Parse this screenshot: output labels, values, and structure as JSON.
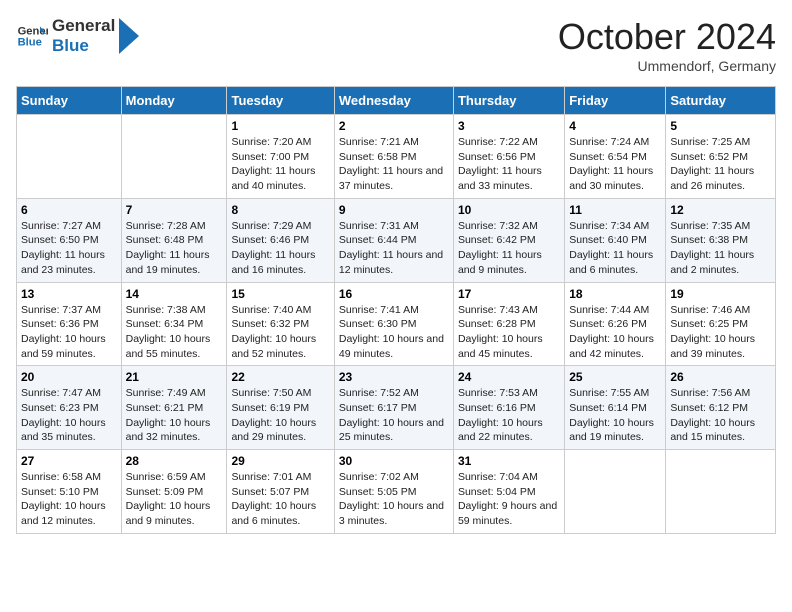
{
  "header": {
    "logo_line1": "General",
    "logo_line2": "Blue",
    "month": "October 2024",
    "location": "Ummendorf, Germany"
  },
  "weekdays": [
    "Sunday",
    "Monday",
    "Tuesday",
    "Wednesday",
    "Thursday",
    "Friday",
    "Saturday"
  ],
  "weeks": [
    [
      {
        "day": "",
        "info": ""
      },
      {
        "day": "",
        "info": ""
      },
      {
        "day": "1",
        "info": "Sunrise: 7:20 AM\nSunset: 7:00 PM\nDaylight: 11 hours and 40 minutes."
      },
      {
        "day": "2",
        "info": "Sunrise: 7:21 AM\nSunset: 6:58 PM\nDaylight: 11 hours and 37 minutes."
      },
      {
        "day": "3",
        "info": "Sunrise: 7:22 AM\nSunset: 6:56 PM\nDaylight: 11 hours and 33 minutes."
      },
      {
        "day": "4",
        "info": "Sunrise: 7:24 AM\nSunset: 6:54 PM\nDaylight: 11 hours and 30 minutes."
      },
      {
        "day": "5",
        "info": "Sunrise: 7:25 AM\nSunset: 6:52 PM\nDaylight: 11 hours and 26 minutes."
      }
    ],
    [
      {
        "day": "6",
        "info": "Sunrise: 7:27 AM\nSunset: 6:50 PM\nDaylight: 11 hours and 23 minutes."
      },
      {
        "day": "7",
        "info": "Sunrise: 7:28 AM\nSunset: 6:48 PM\nDaylight: 11 hours and 19 minutes."
      },
      {
        "day": "8",
        "info": "Sunrise: 7:29 AM\nSunset: 6:46 PM\nDaylight: 11 hours and 16 minutes."
      },
      {
        "day": "9",
        "info": "Sunrise: 7:31 AM\nSunset: 6:44 PM\nDaylight: 11 hours and 12 minutes."
      },
      {
        "day": "10",
        "info": "Sunrise: 7:32 AM\nSunset: 6:42 PM\nDaylight: 11 hours and 9 minutes."
      },
      {
        "day": "11",
        "info": "Sunrise: 7:34 AM\nSunset: 6:40 PM\nDaylight: 11 hours and 6 minutes."
      },
      {
        "day": "12",
        "info": "Sunrise: 7:35 AM\nSunset: 6:38 PM\nDaylight: 11 hours and 2 minutes."
      }
    ],
    [
      {
        "day": "13",
        "info": "Sunrise: 7:37 AM\nSunset: 6:36 PM\nDaylight: 10 hours and 59 minutes."
      },
      {
        "day": "14",
        "info": "Sunrise: 7:38 AM\nSunset: 6:34 PM\nDaylight: 10 hours and 55 minutes."
      },
      {
        "day": "15",
        "info": "Sunrise: 7:40 AM\nSunset: 6:32 PM\nDaylight: 10 hours and 52 minutes."
      },
      {
        "day": "16",
        "info": "Sunrise: 7:41 AM\nSunset: 6:30 PM\nDaylight: 10 hours and 49 minutes."
      },
      {
        "day": "17",
        "info": "Sunrise: 7:43 AM\nSunset: 6:28 PM\nDaylight: 10 hours and 45 minutes."
      },
      {
        "day": "18",
        "info": "Sunrise: 7:44 AM\nSunset: 6:26 PM\nDaylight: 10 hours and 42 minutes."
      },
      {
        "day": "19",
        "info": "Sunrise: 7:46 AM\nSunset: 6:25 PM\nDaylight: 10 hours and 39 minutes."
      }
    ],
    [
      {
        "day": "20",
        "info": "Sunrise: 7:47 AM\nSunset: 6:23 PM\nDaylight: 10 hours and 35 minutes."
      },
      {
        "day": "21",
        "info": "Sunrise: 7:49 AM\nSunset: 6:21 PM\nDaylight: 10 hours and 32 minutes."
      },
      {
        "day": "22",
        "info": "Sunrise: 7:50 AM\nSunset: 6:19 PM\nDaylight: 10 hours and 29 minutes."
      },
      {
        "day": "23",
        "info": "Sunrise: 7:52 AM\nSunset: 6:17 PM\nDaylight: 10 hours and 25 minutes."
      },
      {
        "day": "24",
        "info": "Sunrise: 7:53 AM\nSunset: 6:16 PM\nDaylight: 10 hours and 22 minutes."
      },
      {
        "day": "25",
        "info": "Sunrise: 7:55 AM\nSunset: 6:14 PM\nDaylight: 10 hours and 19 minutes."
      },
      {
        "day": "26",
        "info": "Sunrise: 7:56 AM\nSunset: 6:12 PM\nDaylight: 10 hours and 15 minutes."
      }
    ],
    [
      {
        "day": "27",
        "info": "Sunrise: 6:58 AM\nSunset: 5:10 PM\nDaylight: 10 hours and 12 minutes."
      },
      {
        "day": "28",
        "info": "Sunrise: 6:59 AM\nSunset: 5:09 PM\nDaylight: 10 hours and 9 minutes."
      },
      {
        "day": "29",
        "info": "Sunrise: 7:01 AM\nSunset: 5:07 PM\nDaylight: 10 hours and 6 minutes."
      },
      {
        "day": "30",
        "info": "Sunrise: 7:02 AM\nSunset: 5:05 PM\nDaylight: 10 hours and 3 minutes."
      },
      {
        "day": "31",
        "info": "Sunrise: 7:04 AM\nSunset: 5:04 PM\nDaylight: 9 hours and 59 minutes."
      },
      {
        "day": "",
        "info": ""
      },
      {
        "day": "",
        "info": ""
      }
    ]
  ]
}
